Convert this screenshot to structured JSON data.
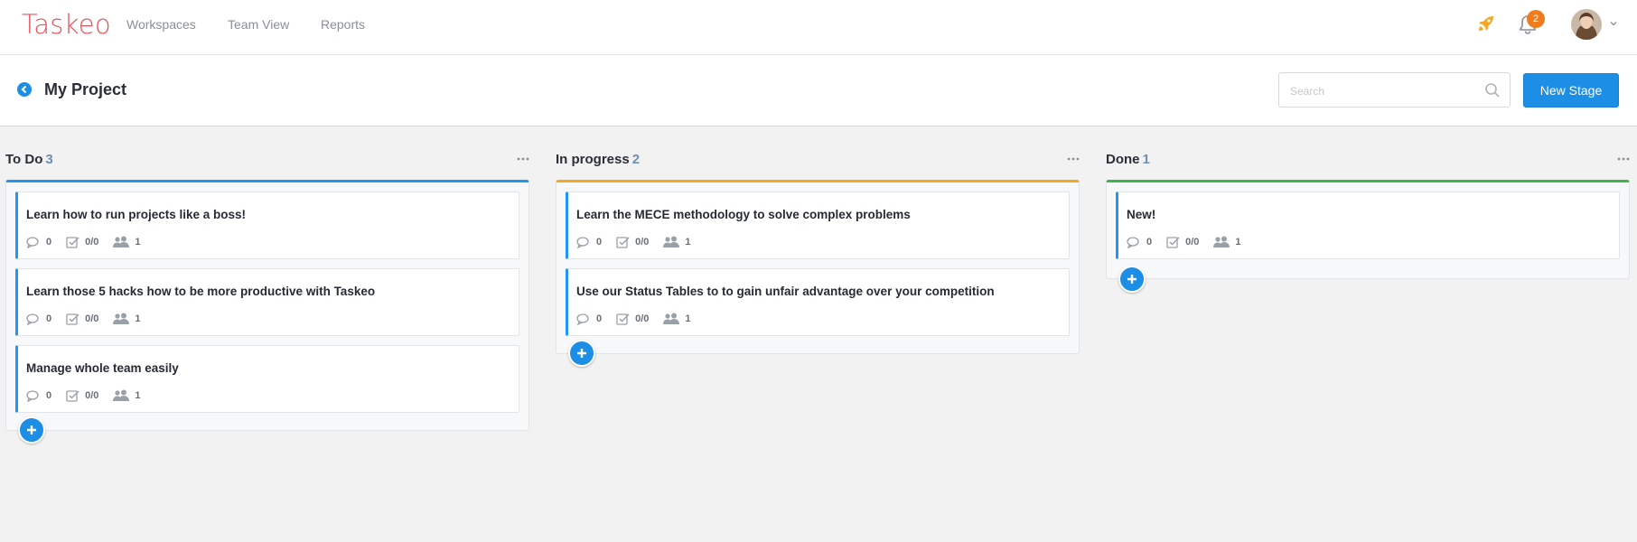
{
  "nav": {
    "logo": "Taskeo",
    "links": [
      "Workspaces",
      "Team View",
      "Reports"
    ],
    "notifications": "2"
  },
  "header": {
    "title": "My Project",
    "search_placeholder": "Search",
    "new_stage_label": "New Stage"
  },
  "columns": [
    {
      "title": "To Do",
      "count": "3",
      "cards": [
        {
          "title": "Learn how to run projects like a boss!",
          "comments": "0",
          "checklist": "0/0",
          "members": "1"
        },
        {
          "title": "Learn those 5 hacks how to be more productive with Taskeo",
          "comments": "0",
          "checklist": "0/0",
          "members": "1"
        },
        {
          "title": "Manage whole team easily",
          "comments": "0",
          "checklist": "0/0",
          "members": "1"
        }
      ]
    },
    {
      "title": "In progress",
      "count": "2",
      "cards": [
        {
          "title": "Learn the MECE methodology to solve complex problems",
          "comments": "0",
          "checklist": "0/0",
          "members": "1"
        },
        {
          "title": "Use our Status Tables to to gain unfair advantage over your competition",
          "comments": "0",
          "checklist": "0/0",
          "members": "1"
        }
      ]
    },
    {
      "title": "Done",
      "count": "1",
      "cards": [
        {
          "title": "New!",
          "comments": "0",
          "checklist": "0/0",
          "members": "1"
        }
      ]
    }
  ],
  "colors": {
    "accent": "#1d8ee6",
    "logo": "#e9505a",
    "todo": "#2196f3",
    "in_progress": "#f5a623",
    "done": "#3bb54a",
    "badge": "#f07b1d"
  }
}
